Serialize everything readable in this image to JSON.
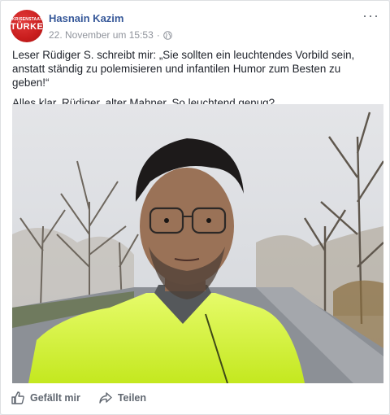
{
  "post": {
    "author": "Hasnain Kazim",
    "avatar_text_top": "KRISENSTAAT",
    "avatar_text_main": "TÜRKEI",
    "timestamp": "22. November um 15:53",
    "separator": "·",
    "privacy_icon": "globe-icon",
    "more_label": "···",
    "text_paragraphs": [
      "Leser Rüdiger S. schreibt mir: „Sie sollten ein leuchtendes Vorbild sein, anstatt ständig zu polemisieren und infantilen Humor zum Besten zu geben!“",
      "Alles klar, Rüdiger, alter Mahner. So leuchtend genug?"
    ]
  },
  "actions": {
    "like_label": "Gefällt mir",
    "like_icon": "thumbs-up-icon",
    "share_label": "Teilen",
    "share_icon": "share-arrow-icon"
  },
  "colors": {
    "author_link": "#365899",
    "meta_gray": "#90949c",
    "jacket": "#d7f542"
  }
}
